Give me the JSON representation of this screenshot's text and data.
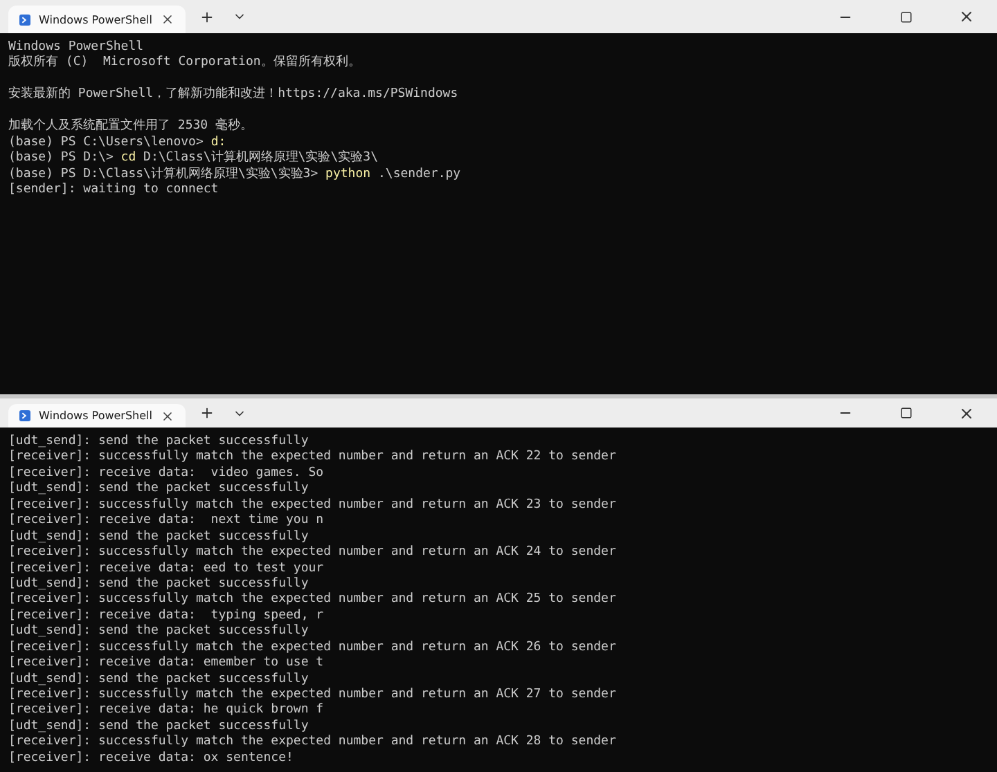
{
  "windows": [
    {
      "tab": {
        "title": "Windows PowerShell",
        "selected": true
      },
      "lines": [
        {
          "blank_before": false,
          "segments": [
            {
              "text": "Windows PowerShell",
              "highlight": false
            }
          ]
        },
        {
          "blank_before": false,
          "segments": [
            {
              "text": "版权所有 (C)  Microsoft Corporation。保留所有权利。",
              "highlight": false
            }
          ]
        },
        {
          "blank_before": true,
          "segments": [
            {
              "text": "安装最新的 PowerShell，了解新功能和改进！https://aka.ms/PSWindows",
              "highlight": false
            }
          ]
        },
        {
          "blank_before": true,
          "segments": [
            {
              "text": "加载个人及系统配置文件用了 2530 毫秒。",
              "highlight": false
            }
          ]
        },
        {
          "blank_before": false,
          "segments": [
            {
              "text": "(base) PS C:\\Users\\lenovo> ",
              "highlight": false
            },
            {
              "text": "d:",
              "highlight": true
            }
          ]
        },
        {
          "blank_before": false,
          "segments": [
            {
              "text": "(base) PS D:\\> ",
              "highlight": false
            },
            {
              "text": "cd",
              "highlight": true
            },
            {
              "text": " D:\\Class\\计算机网络原理\\实验\\实验3\\",
              "highlight": false
            }
          ]
        },
        {
          "blank_before": false,
          "segments": [
            {
              "text": "(base) PS D:\\Class\\计算机网络原理\\实验\\实验3> ",
              "highlight": false
            },
            {
              "text": "python",
              "highlight": true
            },
            {
              "text": " .\\sender.py",
              "highlight": false
            }
          ]
        },
        {
          "blank_before": false,
          "segments": [
            {
              "text": "[sender]: waiting to connect",
              "highlight": false
            }
          ]
        }
      ]
    },
    {
      "tab": {
        "title": "Windows PowerShell",
        "selected": true
      },
      "lines": [
        {
          "blank_before": false,
          "segments": [
            {
              "text": "[udt_send]: send the packet successfully",
              "highlight": false
            }
          ]
        },
        {
          "blank_before": false,
          "segments": [
            {
              "text": "[receiver]: successfully match the expected number and return an ACK 22 to sender",
              "highlight": false
            }
          ]
        },
        {
          "blank_before": false,
          "segments": [
            {
              "text": "[receiver]: receive data:  video games. So",
              "highlight": false
            }
          ]
        },
        {
          "blank_before": false,
          "segments": [
            {
              "text": "[udt_send]: send the packet successfully",
              "highlight": false
            }
          ]
        },
        {
          "blank_before": false,
          "segments": [
            {
              "text": "[receiver]: successfully match the expected number and return an ACK 23 to sender",
              "highlight": false
            }
          ]
        },
        {
          "blank_before": false,
          "segments": [
            {
              "text": "[receiver]: receive data:  next time you n",
              "highlight": false
            }
          ]
        },
        {
          "blank_before": false,
          "segments": [
            {
              "text": "[udt_send]: send the packet successfully",
              "highlight": false
            }
          ]
        },
        {
          "blank_before": false,
          "segments": [
            {
              "text": "[receiver]: successfully match the expected number and return an ACK 24 to sender",
              "highlight": false
            }
          ]
        },
        {
          "blank_before": false,
          "segments": [
            {
              "text": "[receiver]: receive data: eed to test your",
              "highlight": false
            }
          ]
        },
        {
          "blank_before": false,
          "segments": [
            {
              "text": "[udt_send]: send the packet successfully",
              "highlight": false
            }
          ]
        },
        {
          "blank_before": false,
          "segments": [
            {
              "text": "[receiver]: successfully match the expected number and return an ACK 25 to sender",
              "highlight": false
            }
          ]
        },
        {
          "blank_before": false,
          "segments": [
            {
              "text": "[receiver]: receive data:  typing speed, r",
              "highlight": false
            }
          ]
        },
        {
          "blank_before": false,
          "segments": [
            {
              "text": "[udt_send]: send the packet successfully",
              "highlight": false
            }
          ]
        },
        {
          "blank_before": false,
          "segments": [
            {
              "text": "[receiver]: successfully match the expected number and return an ACK 26 to sender",
              "highlight": false
            }
          ]
        },
        {
          "blank_before": false,
          "segments": [
            {
              "text": "[receiver]: receive data: emember to use t",
              "highlight": false
            }
          ]
        },
        {
          "blank_before": false,
          "segments": [
            {
              "text": "[udt_send]: send the packet successfully",
              "highlight": false
            }
          ]
        },
        {
          "blank_before": false,
          "segments": [
            {
              "text": "[receiver]: successfully match the expected number and return an ACK 27 to sender",
              "highlight": false
            }
          ]
        },
        {
          "blank_before": false,
          "segments": [
            {
              "text": "[receiver]: receive data: he quick brown f",
              "highlight": false
            }
          ]
        },
        {
          "blank_before": false,
          "segments": [
            {
              "text": "[udt_send]: send the packet successfully",
              "highlight": false
            }
          ]
        },
        {
          "blank_before": false,
          "segments": [
            {
              "text": "[receiver]: successfully match the expected number and return an ACK 28 to sender",
              "highlight": false
            }
          ]
        },
        {
          "blank_before": false,
          "segments": [
            {
              "text": "[receiver]: receive data: ox sentence!",
              "highlight": false
            }
          ]
        }
      ]
    }
  ]
}
